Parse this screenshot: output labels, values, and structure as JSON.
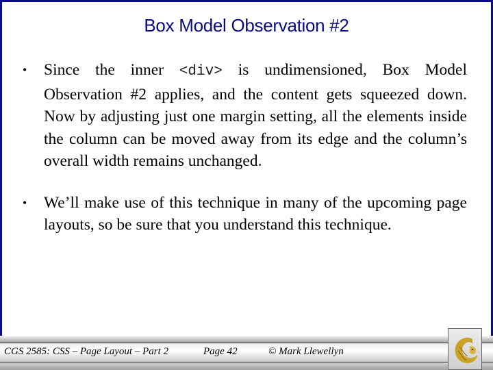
{
  "slide": {
    "title": "Box Model Observation #2",
    "bullets": [
      {
        "marker": "•",
        "text_before": "Since the inner ",
        "code": "<div>",
        "text_after": "  is undimensioned, Box Model Observation #2 applies, and the content gets squeezed down.  Now by adjusting just one margin setting, all the elements inside the column can be moved away from its edge and the column’s overall width remains unchanged."
      },
      {
        "marker": "•",
        "text": "We’ll make use of this technique in many of the upcoming page layouts, so be sure that you understand this technique."
      }
    ]
  },
  "footer": {
    "course": "CGS 2585: CSS – Page Layout – Part 2",
    "page": "Page 42",
    "copyright": "© Mark Llewellyn",
    "logo": "pegasus-logo-icon"
  },
  "colors": {
    "frame_border": "#0a0a8c",
    "title": "#0a0a80",
    "logo_gold": "#c9a227"
  }
}
